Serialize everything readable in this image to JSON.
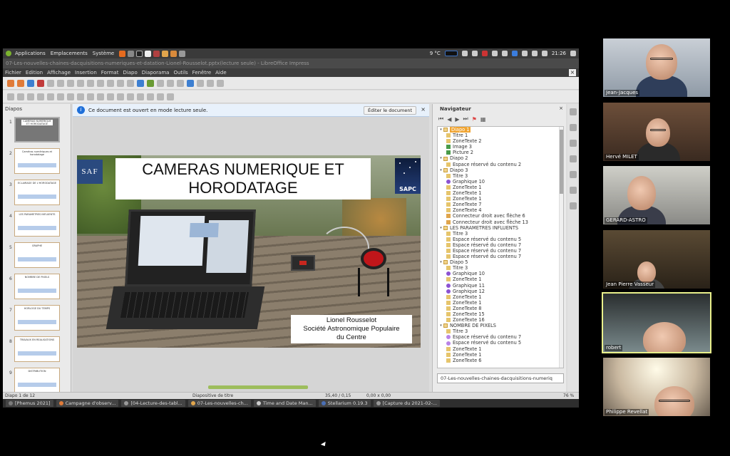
{
  "topbar": {
    "menus": [
      "Applications",
      "Emplacements",
      "Système"
    ],
    "weather": "9 °C",
    "clock": "21:26"
  },
  "window_title": "07-Les-nouvelles-chaines-dacquisitions-numeriques-et-datation-Lionel-Rousselot.pptx(lecture seule) - LibreOffice Impress",
  "menubar": [
    "Fichier",
    "Edition",
    "Affichage",
    "Insertion",
    "Format",
    "Diapo",
    "Diaporama",
    "Outils",
    "Fenêtre",
    "Aide"
  ],
  "slides_pane": {
    "heading": "Diapos",
    "thumbs": [
      {
        "num": "1",
        "title": "CAMERAS NUMERIQUE ET HORODATAGE"
      },
      {
        "num": "2",
        "title": "Caméras numériques et horodatage"
      },
      {
        "num": "3",
        "title": "ECLAIRAGE DE L'HORODATAGE"
      },
      {
        "num": "4",
        "title": "LES PARAMETRES INFLUENTS"
      },
      {
        "num": "5",
        "title": "GRAPHE"
      },
      {
        "num": "6",
        "title": "NOMBRE DE PIXELS"
      },
      {
        "num": "7",
        "title": "HORLOGE DU TEMPS"
      },
      {
        "num": "8",
        "title": "TRAVAUX EN REALISATIONS"
      },
      {
        "num": "9",
        "title": "DISTRIBUTION"
      }
    ]
  },
  "infobar": {
    "message": "Ce document est ouvert en mode lecture seule.",
    "edit_button": "Éditer le document",
    "close": "×"
  },
  "slide": {
    "title": "CAMERAS NUMERIQUE ET HORODATAGE",
    "logo_left": "SAF",
    "logo_right": "SAPC",
    "author": "Lionel Rousselot",
    "org_line1": "Société Astronomique Populaire",
    "org_line2": "du Centre"
  },
  "navigator": {
    "heading": "Navigateur",
    "close": "×",
    "tree": [
      {
        "level": 1,
        "type": "slide",
        "label": "Diapo 1",
        "selected": true
      },
      {
        "level": 2,
        "type": "text",
        "label": "Titre 1"
      },
      {
        "level": 2,
        "type": "text",
        "label": "ZoneTexte 2"
      },
      {
        "level": 2,
        "type": "img",
        "label": "Image 3"
      },
      {
        "level": 2,
        "type": "img",
        "label": "Picture 2"
      },
      {
        "level": 1,
        "type": "slide",
        "label": "Diapo 2"
      },
      {
        "level": 2,
        "type": "text",
        "label": "Espace réservé du contenu 2"
      },
      {
        "level": 1,
        "type": "slide",
        "label": "Diapo 3"
      },
      {
        "level": 2,
        "type": "text",
        "label": "Titre 3"
      },
      {
        "level": 2,
        "type": "graph",
        "label": "Graphique 10"
      },
      {
        "level": 2,
        "type": "text",
        "label": "ZoneTexte 1"
      },
      {
        "level": 2,
        "type": "text",
        "label": "ZoneTexte 1"
      },
      {
        "level": 2,
        "type": "text",
        "label": "ZoneTexte 1"
      },
      {
        "level": 2,
        "type": "text",
        "label": "ZoneTexte 7"
      },
      {
        "level": 2,
        "type": "text",
        "label": "ZoneTexte 4"
      },
      {
        "level": 2,
        "type": "conn",
        "label": "Connecteur droit avec flèche 6"
      },
      {
        "level": 2,
        "type": "conn",
        "label": "Connecteur droit avec flèche 13"
      },
      {
        "level": 1,
        "type": "slide",
        "label": "LES PARAMETRES INFLUENTS"
      },
      {
        "level": 2,
        "type": "text",
        "label": "Titre 3"
      },
      {
        "level": 2,
        "type": "text",
        "label": "Espace réservé du contenu 5"
      },
      {
        "level": 2,
        "type": "text",
        "label": "Espace réservé du contenu 7"
      },
      {
        "level": 2,
        "type": "text",
        "label": "Espace réservé du contenu 7"
      },
      {
        "level": 2,
        "type": "text",
        "label": "Espace réservé du contenu 7"
      },
      {
        "level": 1,
        "type": "slide",
        "label": "Diapo 5"
      },
      {
        "level": 2,
        "type": "text",
        "label": "Titre 3"
      },
      {
        "level": 2,
        "type": "graph",
        "label": "Graphique 10"
      },
      {
        "level": 2,
        "type": "text",
        "label": "ZoneTexte 1"
      },
      {
        "level": 2,
        "type": "graph",
        "label": "Graphique 11"
      },
      {
        "level": 2,
        "type": "graph",
        "label": "Graphique 12"
      },
      {
        "level": 2,
        "type": "text",
        "label": "ZoneTexte 1"
      },
      {
        "level": 2,
        "type": "text",
        "label": "ZoneTexte 1"
      },
      {
        "level": 2,
        "type": "text",
        "label": "ZoneTexte 8"
      },
      {
        "level": 2,
        "type": "text",
        "label": "ZoneTexte 15"
      },
      {
        "level": 2,
        "type": "text",
        "label": "ZoneTexte 16"
      },
      {
        "level": 1,
        "type": "slide",
        "label": "NOMBRE DE PIXELS"
      },
      {
        "level": 2,
        "type": "text",
        "label": "Titre 3"
      },
      {
        "level": 2,
        "type": "ph",
        "label": "Espace réservé du contenu 7"
      },
      {
        "level": 2,
        "type": "ph",
        "label": "Espace réservé du contenu 5"
      },
      {
        "level": 2,
        "type": "text",
        "label": "ZoneTexte 1"
      },
      {
        "level": 2,
        "type": "text",
        "label": "ZoneTexte 1"
      },
      {
        "level": 2,
        "type": "text",
        "label": "ZoneTexte 6"
      }
    ],
    "dropdown": "07-Les-nouvelles-chaines-dacquisitions-numeriq"
  },
  "statusbar": {
    "slide_pos": "Diapo 1 de 12",
    "layout": "Diapositive de titre",
    "coords": "35,40 / 0,15",
    "size": "0,00 x 0,00",
    "zoom": "76 %"
  },
  "taskbar": [
    {
      "label": "[Phemus 2021]",
      "color": "#7b7b7b"
    },
    {
      "label": "Campagne d'observ...",
      "color": "#e07b39"
    },
    {
      "label": "[04-Lecture-des-tabl...",
      "color": "#999"
    },
    {
      "label": "07-Les-nouvelles-ch...",
      "color": "#e0a54c"
    },
    {
      "label": "Time and Date Man...",
      "color": "#ccc"
    },
    {
      "label": "Stellarium 0.19.3",
      "color": "#4a6fb5"
    },
    {
      "label": "[Capture du 2021-02-...",
      "color": "#999"
    }
  ],
  "participants": [
    {
      "name": "Jean-Jacques",
      "active": false
    },
    {
      "name": "Hervé MILET",
      "active": false
    },
    {
      "name": "GERARD-ASTRO",
      "active": false
    },
    {
      "name": "Jean Pierre Vasseur",
      "active": false
    },
    {
      "name": "robert",
      "active": true
    },
    {
      "name": "Philippe Revellat",
      "active": false
    }
  ]
}
